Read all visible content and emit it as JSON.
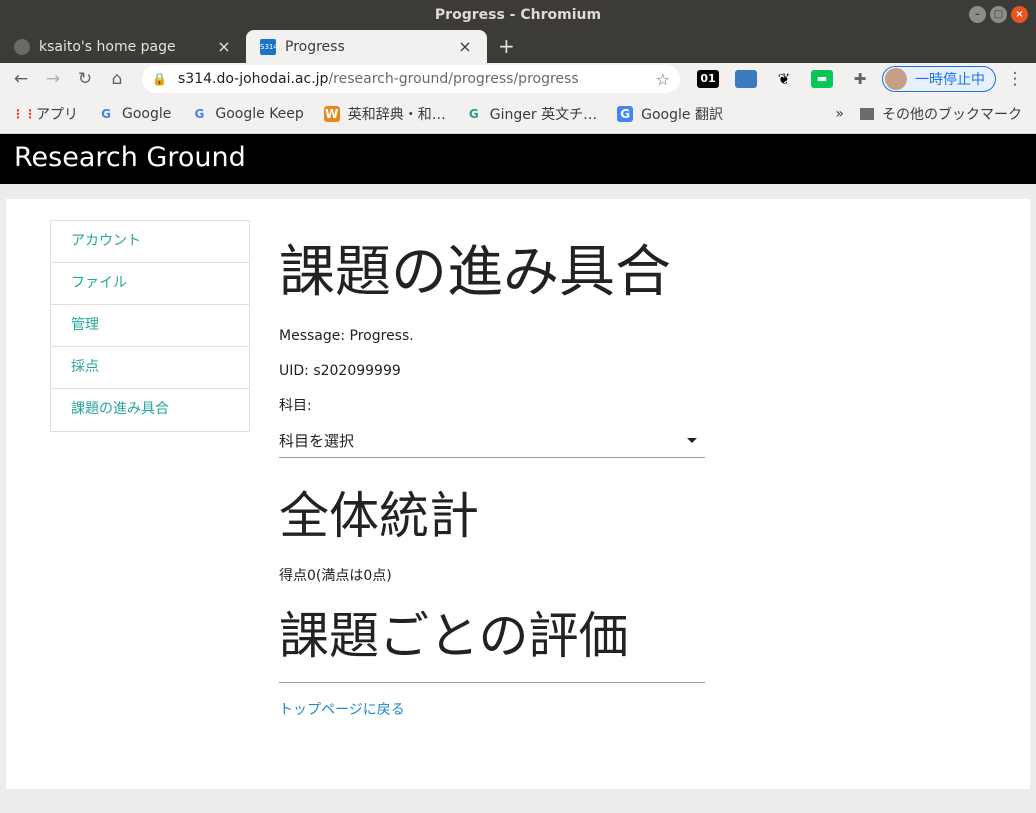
{
  "window": {
    "title": "Progress - Chromium"
  },
  "tabs": [
    {
      "label": "ksaito's home page"
    },
    {
      "label": "Progress",
      "favicon_text": "S314"
    }
  ],
  "toolbar": {
    "url_host": "s314.do-johodai.ac.jp",
    "url_path": "/research-ground/progress/progress",
    "profile_label": "一時停止中",
    "ext1_label": "01"
  },
  "bookmarks": {
    "items": [
      {
        "label": "アプリ"
      },
      {
        "label": "Google"
      },
      {
        "label": "Google Keep"
      },
      {
        "label": "英和辞典・和…"
      },
      {
        "label": "Ginger 英文チ…"
      },
      {
        "label": "Google 翻訳"
      }
    ],
    "more": "»",
    "other": "その他のブックマーク"
  },
  "navbar": {
    "brand": "Research Ground"
  },
  "sidenav": [
    {
      "label": "アカウント"
    },
    {
      "label": "ファイル"
    },
    {
      "label": "管理"
    },
    {
      "label": "採点"
    },
    {
      "label": "課題の進み具合"
    }
  ],
  "main": {
    "title": "課題の進み具合",
    "message": "Message: Progress.",
    "uid": "UID: s202099999",
    "subject_label": "科目:",
    "subject_select": "科目を選択",
    "stats_heading": "全体統計",
    "score_text": "得点0(満点は0点)",
    "eval_heading": "課題ごとの評価",
    "back_link": "トップページに戻る"
  },
  "colors": {
    "accent": "#26a69a",
    "link": "#1e88c8",
    "navbar_bg": "#000000"
  }
}
